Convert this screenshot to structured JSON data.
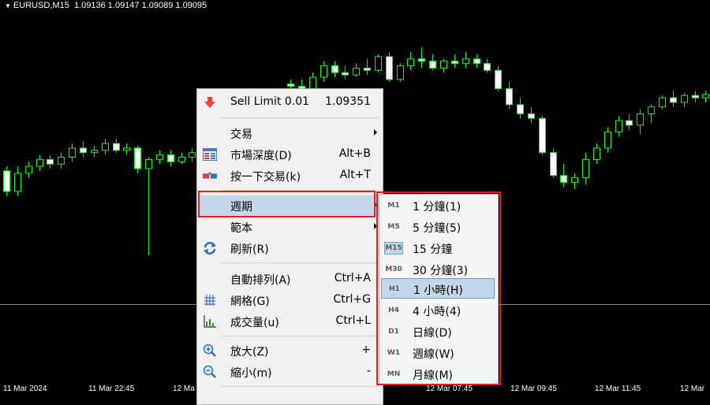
{
  "chart": {
    "symbol_timeframe": "EURUSD,M15",
    "ohlc": "1.09136 1.09147 1.09089 1.09095",
    "x_labels": [
      "11 Mar 2024",
      "11 Mar 22:45",
      "12 Ma",
      "12 Mar 07:45",
      "12 Mar 09:45",
      "12 Mar 11:45",
      "12 Mar"
    ],
    "up_color": "#00ff00",
    "bar_fill": "#ffffff",
    "candles": [
      [
        1.09155,
        1.09165,
        1.091,
        1.0911
      ],
      [
        1.0911,
        1.09165,
        1.091,
        1.0915
      ],
      [
        1.0915,
        1.09175,
        1.0914,
        1.09165
      ],
      [
        1.09165,
        1.0919,
        1.09155,
        1.0918
      ],
      [
        1.0918,
        1.0919,
        1.0916,
        1.0917
      ],
      [
        1.0917,
        1.09195,
        1.0916,
        1.09185
      ],
      [
        1.09185,
        1.09215,
        1.09175,
        1.09205
      ],
      [
        1.09205,
        1.0922,
        1.09185,
        1.09195
      ],
      [
        1.09195,
        1.0921,
        1.09185,
        1.092
      ],
      [
        1.092,
        1.09225,
        1.0919,
        1.09215
      ],
      [
        1.09215,
        1.09225,
        1.09195,
        1.092
      ],
      [
        1.092,
        1.09215,
        1.0919,
        1.09205
      ],
      [
        1.09205,
        1.0921,
        1.0915,
        1.0916
      ],
      [
        1.0916,
        1.09185,
        1.0897,
        1.0918
      ],
      [
        1.0918,
        1.092,
        1.0917,
        1.0919
      ],
      [
        1.0919,
        1.092,
        1.09165,
        1.09175
      ],
      [
        1.09175,
        1.09195,
        1.0917,
        1.09185
      ],
      [
        1.09185,
        1.09205,
        1.09175,
        1.09195
      ],
      [
        1.09195,
        1.0922,
        1.09185,
        1.0921
      ],
      [
        1.0921,
        1.09215,
        1.09185,
        1.09195
      ],
      [
        1.09195,
        1.0921,
        1.09185,
        1.0919
      ],
      [
        1.0919,
        1.09225,
        1.09185,
        1.09215
      ],
      [
        1.09215,
        1.0924,
        1.09205,
        1.0923
      ],
      [
        1.0923,
        1.09265,
        1.0922,
        1.0924
      ],
      [
        1.0924,
        1.0927,
        1.09235,
        1.0925
      ],
      [
        1.0925,
        1.09265,
        1.09245,
        1.09255
      ],
      [
        1.09345,
        1.09355,
        1.0933,
        1.0934
      ],
      [
        1.0934,
        1.09355,
        1.09325,
        1.09335
      ],
      [
        1.09335,
        1.0937,
        1.0933,
        1.0936
      ],
      [
        1.0936,
        1.09395,
        1.0935,
        1.09385
      ],
      [
        1.09385,
        1.09395,
        1.0936,
        1.0937
      ],
      [
        1.0937,
        1.09385,
        1.09355,
        1.09365
      ],
      [
        1.09365,
        1.0939,
        1.0936,
        1.0938
      ],
      [
        1.0938,
        1.094,
        1.09365,
        1.09375
      ],
      [
        1.09375,
        1.0941,
        1.0937,
        1.09405
      ],
      [
        1.09405,
        1.09415,
        1.0935,
        1.09355
      ],
      [
        1.09355,
        1.0939,
        1.0935,
        1.09385
      ],
      [
        1.09385,
        1.09415,
        1.09375,
        1.094
      ],
      [
        1.094,
        1.09425,
        1.0938,
        1.09395
      ],
      [
        1.09395,
        1.0941,
        1.09375,
        1.0938
      ],
      [
        1.0938,
        1.094,
        1.0937,
        1.09395
      ],
      [
        1.09395,
        1.0941,
        1.0938,
        1.0939
      ],
      [
        1.0939,
        1.09415,
        1.0938,
        1.094
      ],
      [
        1.094,
        1.0941,
        1.0938,
        1.0939
      ],
      [
        1.0939,
        1.094,
        1.0937,
        1.09375
      ],
      [
        1.09375,
        1.09385,
        1.0933,
        1.09335
      ],
      [
        1.09335,
        1.0935,
        1.0929,
        1.093
      ],
      [
        1.093,
        1.09315,
        1.0927,
        1.0928
      ],
      [
        1.0928,
        1.09295,
        1.0926,
        1.0927
      ],
      [
        1.0927,
        1.09275,
        1.0919,
        1.09195
      ],
      [
        1.09195,
        1.09205,
        1.0914,
        1.09145
      ],
      [
        1.09145,
        1.0917,
        1.0912,
        1.0913
      ],
      [
        1.0913,
        1.0915,
        1.09115,
        1.0914
      ],
      [
        1.0914,
        1.09195,
        1.09125,
        1.0918
      ],
      [
        1.0918,
        1.09215,
        1.0917,
        1.09205
      ],
      [
        1.09205,
        1.0925,
        1.09195,
        1.0924
      ],
      [
        1.0924,
        1.09275,
        1.0923,
        1.09265
      ],
      [
        1.09265,
        1.0928,
        1.09245,
        1.09255
      ],
      [
        1.09255,
        1.0929,
        1.09235,
        1.0928
      ],
      [
        1.0928,
        1.093,
        1.0926,
        1.09295
      ],
      [
        1.09295,
        1.0932,
        1.0929,
        1.09315
      ],
      [
        1.09315,
        1.0933,
        1.09295,
        1.09305
      ],
      [
        1.09305,
        1.09325,
        1.09295,
        1.0932
      ],
      [
        1.0932,
        1.0933,
        1.09305,
        1.09315
      ],
      [
        1.09315,
        1.0933,
        1.09305,
        1.09322
      ]
    ]
  },
  "context_menu": {
    "items": [
      {
        "label": "Sell Limit 0.01",
        "shortcut": "1.09351",
        "icon": "sell-limit-arrow-icon"
      },
      {
        "label": "交易",
        "submenu": true
      },
      {
        "label": "市場深度(D)",
        "shortcut": "Alt+B",
        "icon": "market-depth-icon"
      },
      {
        "label": "按一下交易(k)",
        "shortcut": "Alt+T",
        "icon": "one-click-trading-icon"
      },
      {
        "label": "週期",
        "submenu": true
      },
      {
        "label": "範本",
        "submenu": true
      },
      {
        "label": "刷新(R)",
        "icon": "refresh-icon"
      },
      {
        "label": "自動排列(A)",
        "shortcut": "Ctrl+A"
      },
      {
        "label": "網格(G)",
        "shortcut": "Ctrl+G",
        "icon": "grid-icon"
      },
      {
        "label": "成交量(u)",
        "shortcut": "Ctrl+L",
        "icon": "volumes-icon"
      },
      {
        "label": "放大(Z)",
        "shortcut": "+",
        "icon": "zoom-in-icon"
      },
      {
        "label": "縮小(m)",
        "shortcut": "-",
        "icon": "zoom-out-icon"
      }
    ]
  },
  "period_submenu": {
    "items": [
      {
        "code": "M1",
        "label": "1 分鐘(1)"
      },
      {
        "code": "M5",
        "label": "5 分鐘(5)"
      },
      {
        "code": "M15",
        "label": "15 分鐘"
      },
      {
        "code": "M30",
        "label": "30 分鐘(3)"
      },
      {
        "code": "H1",
        "label": "1 小時(H)"
      },
      {
        "code": "H4",
        "label": "4 小時(4)"
      },
      {
        "code": "D1",
        "label": "日線(D)"
      },
      {
        "code": "W1",
        "label": "週線(W)"
      },
      {
        "code": "MN",
        "label": "月線(M)"
      }
    ],
    "checked": "M15",
    "hovered": "H1"
  },
  "highlight_color": "#e02020"
}
